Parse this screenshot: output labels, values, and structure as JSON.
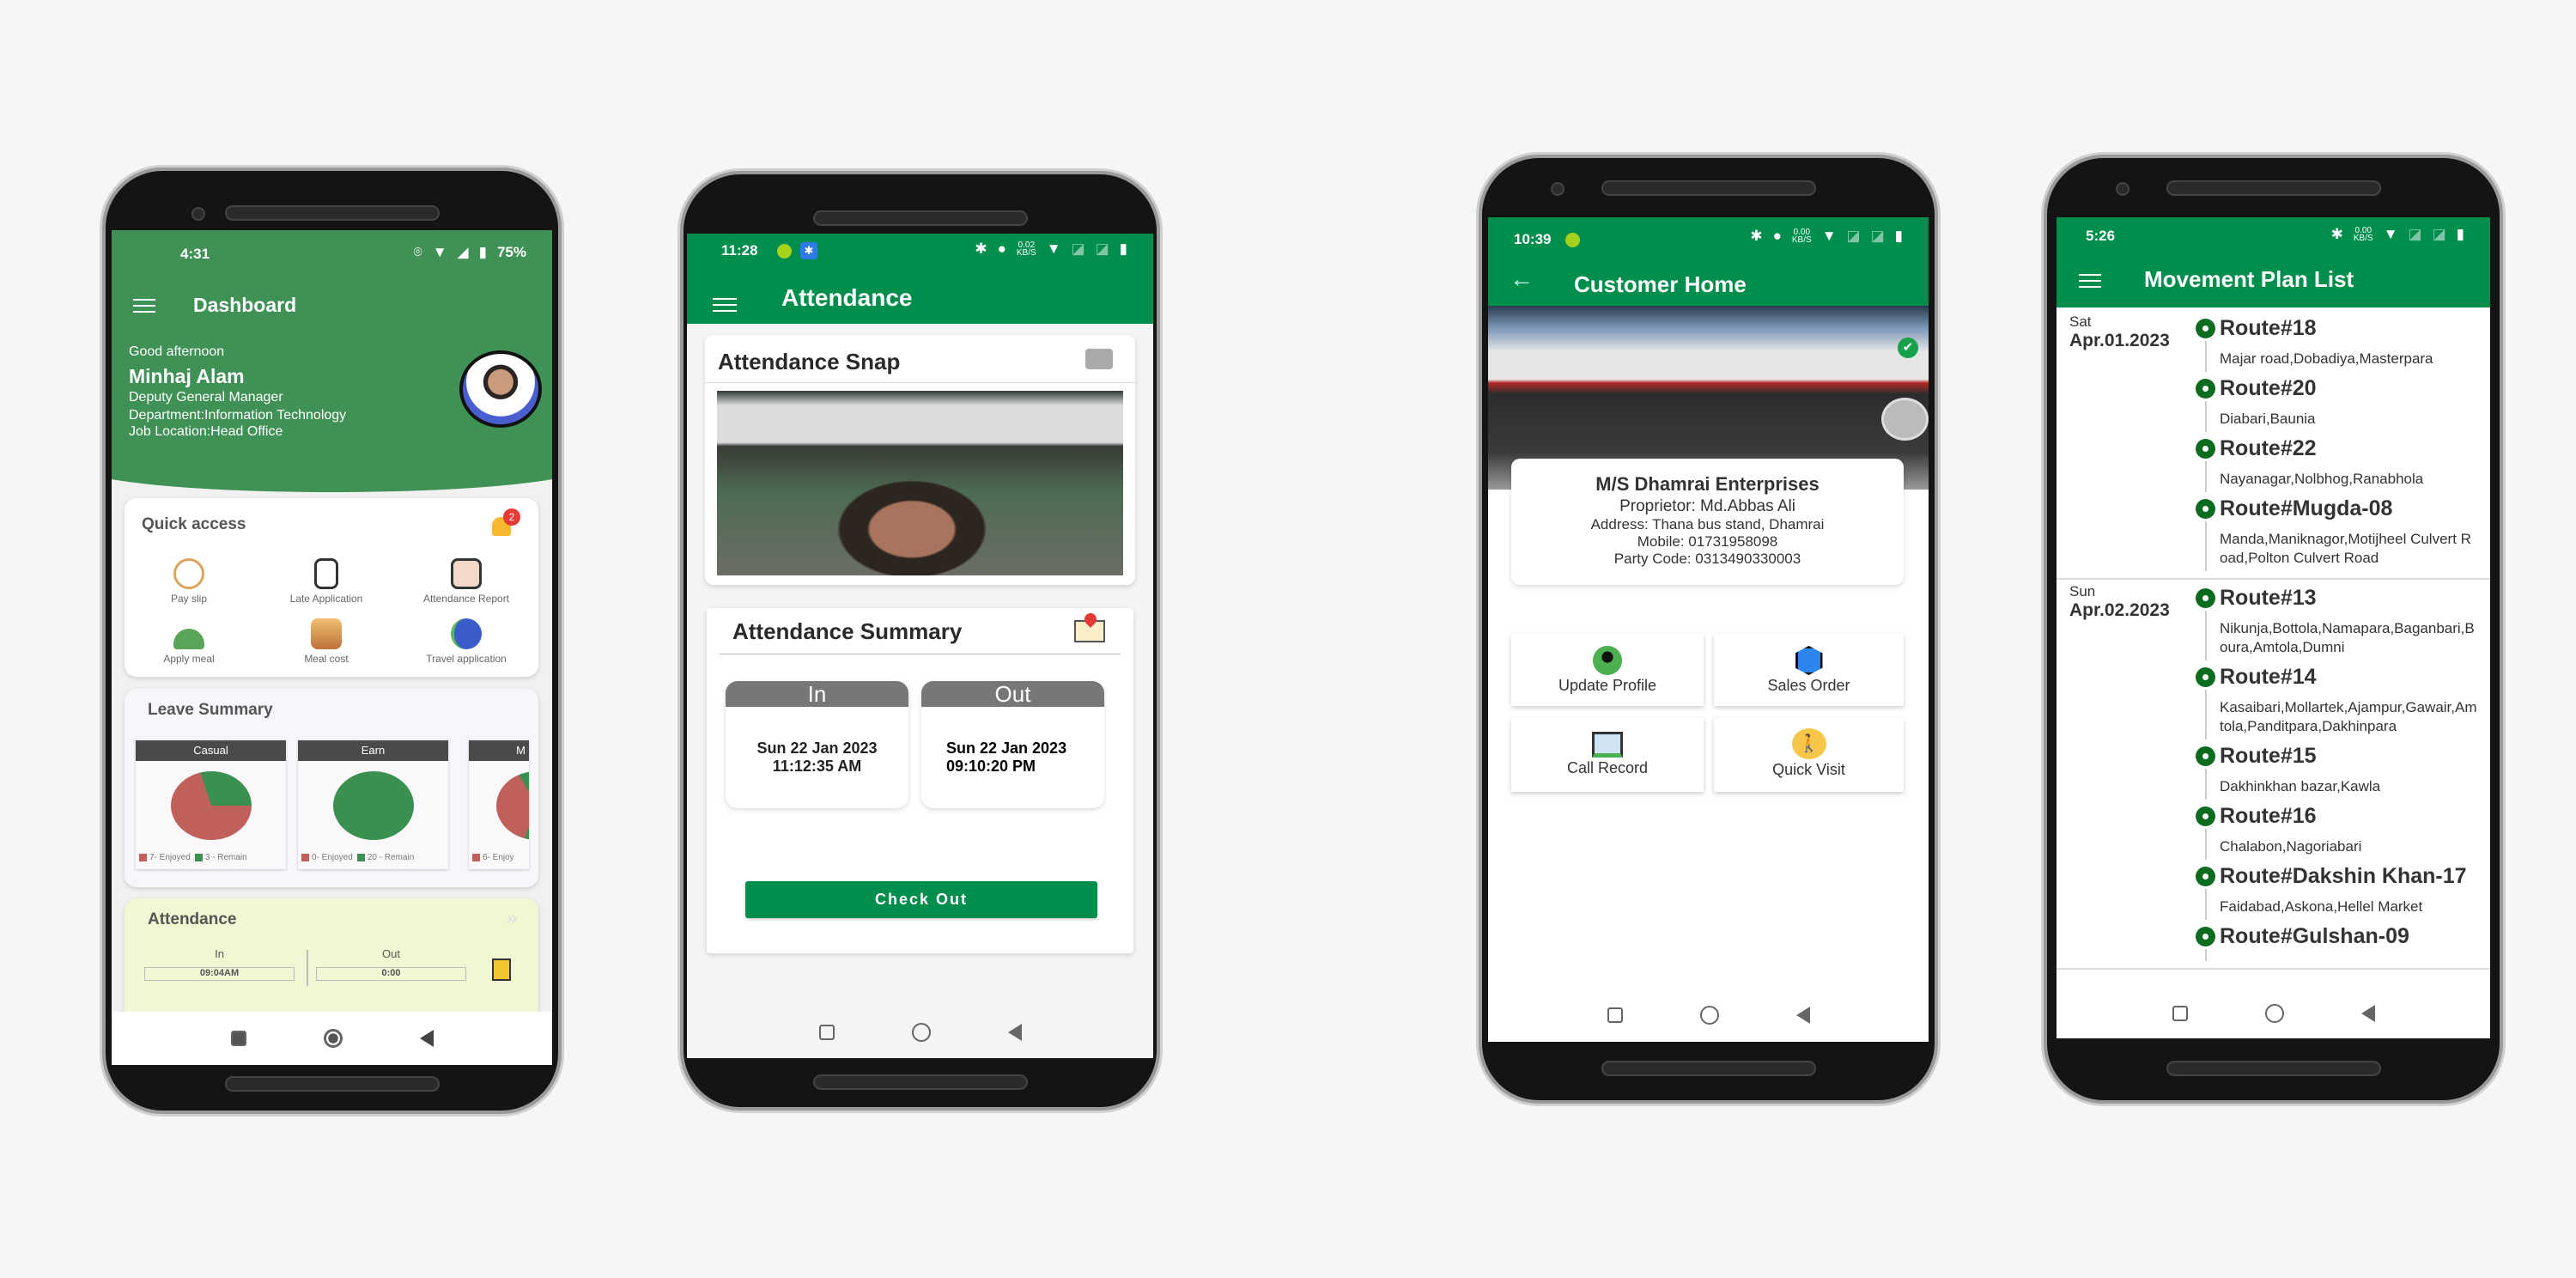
{
  "colors": {
    "green_dashboard": "#3f9155",
    "green_app": "#008e4c",
    "red_pie": "#c0605a",
    "green_pie": "#3a9050"
  },
  "dashboard": {
    "status": {
      "time": "4:31",
      "battery": "75%"
    },
    "title": "Dashboard",
    "greeting": "Good afternoon",
    "name": "Minhaj Alam",
    "designation": "Deputy General Manager",
    "department": "Department:Information Technology",
    "location": "Job Location:Head Office",
    "quick_access": {
      "title": "Quick access",
      "badge": "2",
      "items": [
        {
          "label": "Pay slip",
          "icon": "payslip-icon"
        },
        {
          "label": "Late Application",
          "icon": "late-application-icon"
        },
        {
          "label": "Attendance Report",
          "icon": "attendance-report-icon"
        },
        {
          "label": "Apply meal",
          "icon": "meal-icon"
        },
        {
          "label": "Meal cost",
          "icon": "meal-cost-icon"
        },
        {
          "label": "Travel application",
          "icon": "travel-icon"
        }
      ]
    },
    "leave_summary": {
      "title": "Leave Summary",
      "cards": [
        {
          "label": "Casual",
          "enjoyed": 7,
          "remain": 3,
          "enjoyed_text": "7- Enjoyed",
          "remain_text": "3 - Remain"
        },
        {
          "label": "Earn",
          "enjoyed": 0,
          "remain": 20,
          "enjoyed_text": "0- Enjoyed",
          "remain_text": "20 - Remain"
        },
        {
          "label": "M",
          "enjoyed": 6,
          "enjoyed_text": "6- Enjoy"
        }
      ]
    },
    "attendance": {
      "title": "Attendance",
      "in_label": "In",
      "in_value": "09:04AM",
      "out_label": "Out",
      "out_value": "0:00"
    }
  },
  "attendance_screen": {
    "status": {
      "time": "11:28",
      "speed": "0.02",
      "speed_unit": "KB/S"
    },
    "title": "Attendance",
    "snap_title": "Attendance Snap",
    "summary_title": "Attendance Summary",
    "in_label": "In",
    "in_date": "Sun 22 Jan 2023",
    "in_time": "11:12:35 AM",
    "out_label": "Out",
    "out_date": "Sun 22 Jan 2023",
    "out_time": "09:10:20 PM",
    "checkout_label": "Check Out"
  },
  "customer_home": {
    "status": {
      "time": "10:39",
      "speed": "0.00",
      "speed_unit": "KB/S"
    },
    "title": "Customer Home",
    "name": "M/S Dhamrai Enterprises",
    "proprietor": "Proprietor: Md.Abbas Ali",
    "address": "Address: Thana bus stand, Dhamrai",
    "mobile": "Mobile: 01731958098",
    "party_code": "Party Code: 0313490330003",
    "actions": [
      {
        "label": "Update Profile"
      },
      {
        "label": "Sales Order"
      },
      {
        "label": "Call Record"
      },
      {
        "label": "Quick Visit"
      }
    ]
  },
  "movement_plan": {
    "status": {
      "time": "5:26",
      "speed": "0.00",
      "speed_unit": "KB/S"
    },
    "title": "Movement Plan List",
    "days": [
      {
        "day": "Sat",
        "date": "Apr.01.2023",
        "routes": [
          {
            "name": "Route#18",
            "areas": "Majar road,Dobadiya,Masterpara"
          },
          {
            "name": "Route#20",
            "areas": "Diabari,Baunia"
          },
          {
            "name": "Route#22",
            "areas": "Nayanagar,Nolbhog,Ranabhola"
          },
          {
            "name": "Route#Mugda-08",
            "areas": "Manda,Maniknagor,Motijheel Culvert Road,Polton Culvert Road"
          }
        ]
      },
      {
        "day": "Sun",
        "date": "Apr.02.2023",
        "routes": [
          {
            "name": "Route#13",
            "areas": "Nikunja,Bottola,Namapara,Baganbari,Boura,Amtola,Dumni"
          },
          {
            "name": "Route#14",
            "areas": "Kasaibari,Mollartek,Ajampur,Gawair,Amtola,Panditpara,Dakhinpara"
          },
          {
            "name": "Route#15",
            "areas": "Dakhinkhan bazar,Kawla"
          },
          {
            "name": "Route#16",
            "areas": "Chalabon,Nagoriabari"
          },
          {
            "name": "Route#Dakshin Khan-17",
            "areas": "Faidabad,Askona,Hellel Market"
          },
          {
            "name": "Route#Gulshan-09",
            "areas": ""
          }
        ]
      }
    ]
  }
}
